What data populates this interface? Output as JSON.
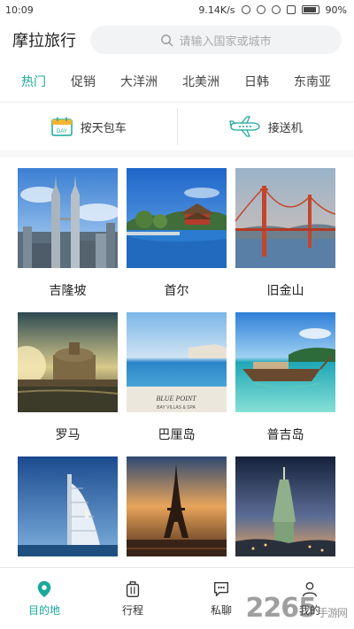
{
  "status_bar": {
    "time": "10:09",
    "speed": "9.14K/s",
    "battery": "90%"
  },
  "header": {
    "title": "摩拉旅行",
    "search_placeholder": "请输入国家或城市"
  },
  "tabs": [
    {
      "label": "热门",
      "active": true
    },
    {
      "label": "促销"
    },
    {
      "label": "大洋洲"
    },
    {
      "label": "北美洲"
    },
    {
      "label": "日韩"
    },
    {
      "label": "东南亚"
    }
  ],
  "services": [
    {
      "label": "按天包车",
      "icon": "calendar-day-icon",
      "icon_text": "DAY"
    },
    {
      "label": "接送机",
      "icon": "airplane-icon"
    }
  ],
  "destinations": [
    {
      "name": "吉隆坡",
      "image": "twin-towers-skyline"
    },
    {
      "name": "首尔",
      "image": "palace-lake"
    },
    {
      "name": "旧金山",
      "image": "golden-gate-bridge"
    },
    {
      "name": "罗马",
      "image": "castle-river-sunset"
    },
    {
      "name": "巴厘岛",
      "image": "infinity-pool-sea",
      "image_text": "BLUE POINT",
      "image_subtext": "BAY VILLAS & SPA"
    },
    {
      "name": "普吉岛",
      "image": "longtail-boat-beach"
    },
    {
      "name": "",
      "image": "sail-hotel-tower"
    },
    {
      "name": "",
      "image": "eiffel-tower-sunset"
    },
    {
      "name": "",
      "image": "taipei-101-night"
    }
  ],
  "bottom_nav": [
    {
      "label": "目的地",
      "icon": "location-pin-icon",
      "active": true
    },
    {
      "label": "行程",
      "icon": "luggage-icon"
    },
    {
      "label": "私聊",
      "icon": "chat-bubble-icon"
    },
    {
      "label": "我的",
      "icon": "person-icon"
    }
  ],
  "watermark": {
    "text": "2265",
    "subtext": "手游网"
  },
  "colors": {
    "accent": "#1aa89b"
  }
}
